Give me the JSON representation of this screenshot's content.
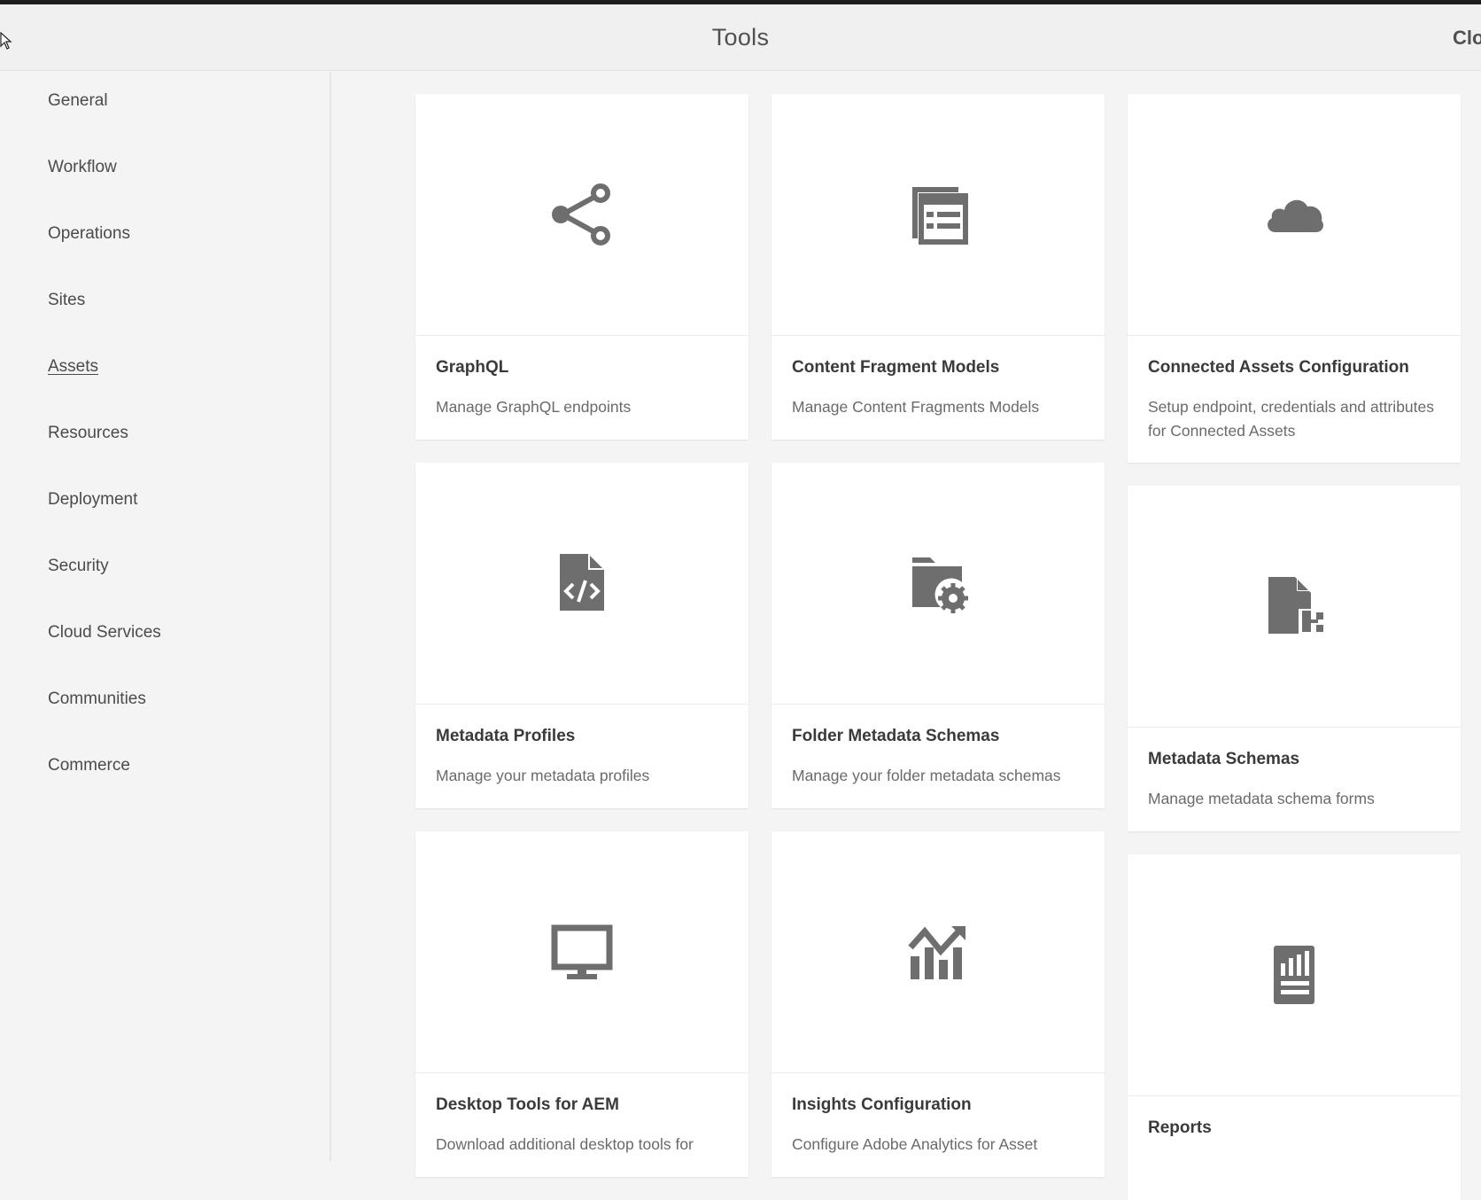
{
  "header": {
    "title": "Tools",
    "close_label": "Clo"
  },
  "sidebar": {
    "items": [
      {
        "label": "General"
      },
      {
        "label": "Workflow"
      },
      {
        "label": "Operations"
      },
      {
        "label": "Sites"
      },
      {
        "label": "Assets",
        "active": true
      },
      {
        "label": "Resources"
      },
      {
        "label": "Deployment"
      },
      {
        "label": "Security"
      },
      {
        "label": "Cloud Services"
      },
      {
        "label": "Communities"
      },
      {
        "label": "Commerce"
      }
    ]
  },
  "cards": [
    {
      "title": "GraphQL",
      "description": "Manage GraphQL endpoints",
      "icon": "share-icon"
    },
    {
      "title": "Content Fragment Models",
      "description": "Manage Content Fragments Models",
      "icon": "content-fragment-icon"
    },
    {
      "title": "Connected Assets Configuration",
      "description": "Setup endpoint, credentials and attributes for Connected Assets",
      "icon": "cloud-icon"
    },
    {
      "title": "Metadata Profiles",
      "description": "Manage your metadata profiles",
      "icon": "file-code-icon"
    },
    {
      "title": "Folder Metadata Schemas",
      "description": "Manage your folder metadata schemas",
      "icon": "folder-gear-icon"
    },
    {
      "title": "Metadata Schemas",
      "description": "Manage metadata schema forms",
      "icon": "file-schema-icon"
    },
    {
      "title": "Desktop Tools for AEM",
      "description": "Download additional desktop tools for",
      "icon": "monitor-icon"
    },
    {
      "title": "Insights Configuration",
      "description": "Configure Adobe Analytics for Asset",
      "icon": "chart-icon"
    },
    {
      "title": "Reports",
      "description": "",
      "icon": "report-icon"
    }
  ],
  "colors": {
    "icon": "#6e6e6e",
    "background": "#f4f4f4",
    "card": "#ffffff"
  }
}
